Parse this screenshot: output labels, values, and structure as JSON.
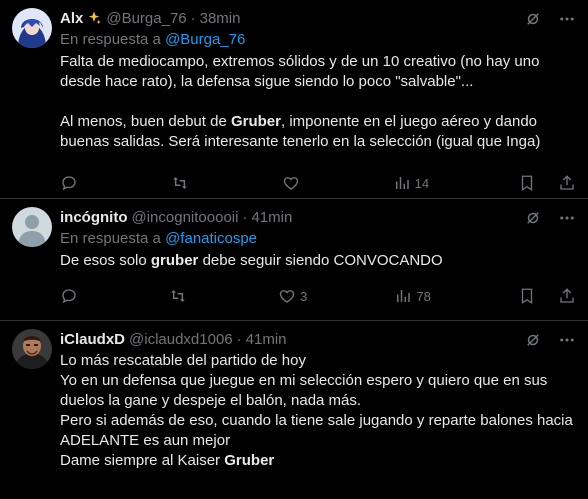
{
  "tweets": [
    {
      "name": "Alx",
      "handle": "@Burga_76",
      "time": "38min",
      "reply_prefix": "En respuesta a ",
      "reply_to": "@Burga_76",
      "paragraphs": [
        [
          "Falta de mediocampo, extremos sólidos y de un 10 creativo (no hay uno desde hace rato), la defensa sigue siendo lo poco \"salvable\"..."
        ],
        [
          "Al menos, buen debut de ",
          {
            "b": "Gruber"
          },
          ", imponente en el juego aéreo y dando buenas salidas. Será interesante tenerlo en la selección (igual que Inga)"
        ]
      ],
      "replies": "",
      "retweets": "",
      "likes": "",
      "views": "14"
    },
    {
      "name": "incógnito",
      "handle": "@incognitooooii",
      "time": "41min",
      "reply_prefix": "En respuesta a ",
      "reply_to": "@fanaticospe",
      "paragraphs": [
        [
          "De esos solo ",
          {
            "b": "gruber"
          },
          " debe seguir siendo CONVOCANDO"
        ]
      ],
      "replies": "",
      "retweets": "",
      "likes": "3",
      "views": "78"
    },
    {
      "name": "iClaudxD",
      "handle": "@iclaudxd1006",
      "time": "41min",
      "reply_prefix": "",
      "reply_to": "",
      "paragraphs": [
        [
          "Lo más rescatable del partido de hoy\nYo en un defensa que juegue en mi selección espero y quiero que en sus duelos la gane y despeje el balón, nada más.\nPero si además de eso, cuando la tiene sale jugando y reparte balones hacia ADELANTE es aun mejor\nDame siempre al Kaiser ",
          {
            "b": "Gruber"
          }
        ]
      ]
    }
  ],
  "icons": {
    "verified_sparkle": "sparkles-icon",
    "grok": "grok-icon",
    "more": "more-icon",
    "reply": "reply-icon",
    "retweet": "retweet-icon",
    "like": "heart-icon",
    "views": "views-icon",
    "bookmark": "bookmark-icon",
    "share": "share-icon"
  },
  "colors": {
    "background": "#000000",
    "text": "#e7e9ea",
    "muted": "#71767b",
    "link": "#1d9bf0",
    "border": "#2f3336"
  }
}
